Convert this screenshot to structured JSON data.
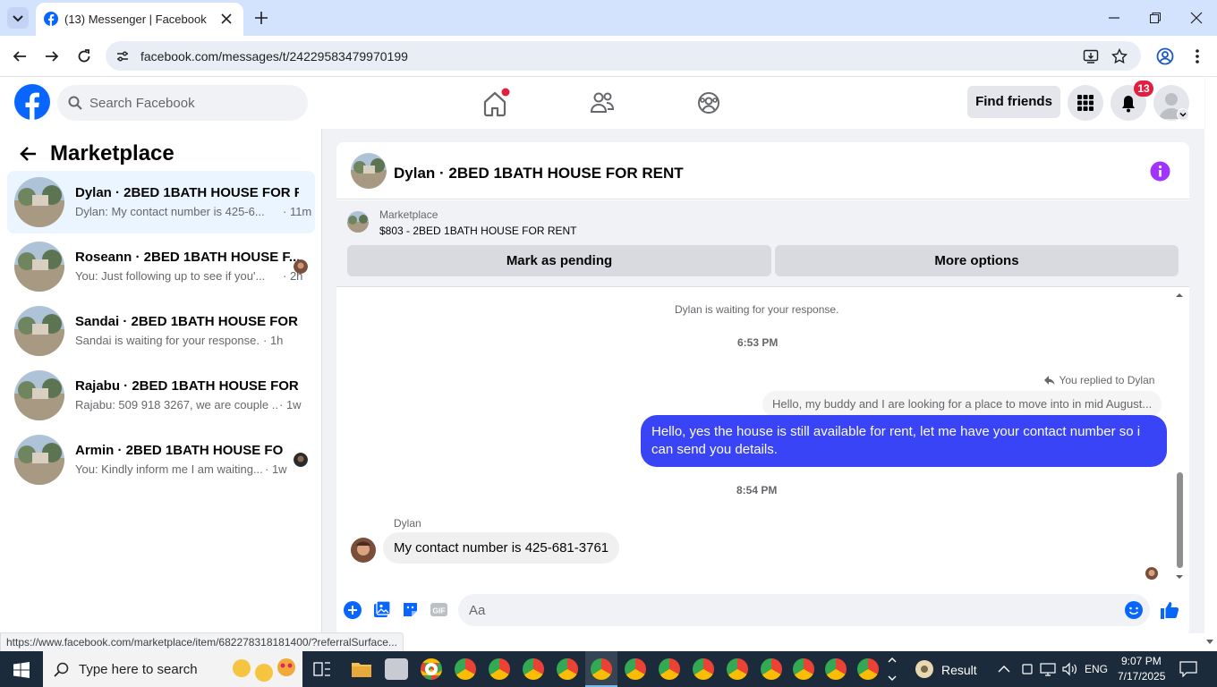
{
  "browser": {
    "tab_title": "(13) Messenger | Facebook",
    "url": "facebook.com/messages/t/24229583479970199"
  },
  "fb_header": {
    "search_placeholder": "Search Facebook",
    "find_friends": "Find friends",
    "notification_count": "13"
  },
  "sidebar": {
    "title": "Marketplace",
    "conversations": [
      {
        "name": "Dylan · 2BED 1BATH HOUSE FOR R...",
        "snippet": "Dylan: My contact number is 425-6...",
        "ago": "· 11m"
      },
      {
        "name": "Roseann · 2BED 1BATH HOUSE F...",
        "snippet": "You: Just following up to see if you'...",
        "ago": "· 2h"
      },
      {
        "name": "Sandai · 2BED 1BATH HOUSE FOR ...",
        "snippet": "Sandai is waiting for your response.",
        "ago": "· 1h"
      },
      {
        "name": "Rajabu · 2BED 1BATH HOUSE FOR ...",
        "snippet": "Rajabu: 509 918 3267, we are couple ...",
        "ago": "· 1w"
      },
      {
        "name": "Armin · 2BED 1BATH HOUSE FO...",
        "snippet": "You: Kindly inform me I am waiting...",
        "ago": "· 1w"
      }
    ]
  },
  "chat": {
    "title": "Dylan · 2BED 1BATH HOUSE FOR RENT",
    "listing_label": "Marketplace",
    "listing_title": "$803 - 2BED 1BATH HOUSE FOR RENT",
    "mark_pending": "Mark as pending",
    "more_options": "More options",
    "waiting_notice": "Dylan is waiting for your response.",
    "time1": "6:53 PM",
    "replied_to": "You replied to Dylan",
    "quoted": "Hello, my buddy and I are looking for a place to move into in mid August...",
    "outgoing": "Hello, yes the house is still available for rent, let me have your contact number so i can send you details.",
    "time2": "8:54 PM",
    "sender": "Dylan",
    "incoming": "My contact number is 425-681-3761",
    "composer_placeholder": "Aa"
  },
  "status_link": "https://www.facebook.com/marketplace/item/682278318181400/?referralSurface...",
  "taskbar": {
    "search_placeholder": "Type here to search",
    "weather": "Result",
    "lang": "ENG",
    "time": "9:07 PM",
    "date": "7/17/2025"
  },
  "colors": {
    "fb_blue": "#0866ff",
    "outgoing_bubble": "#3944f7",
    "unread_badge": "#e41e3f",
    "info_purple": "#a033ff",
    "active_row": "#ebf5ff"
  }
}
